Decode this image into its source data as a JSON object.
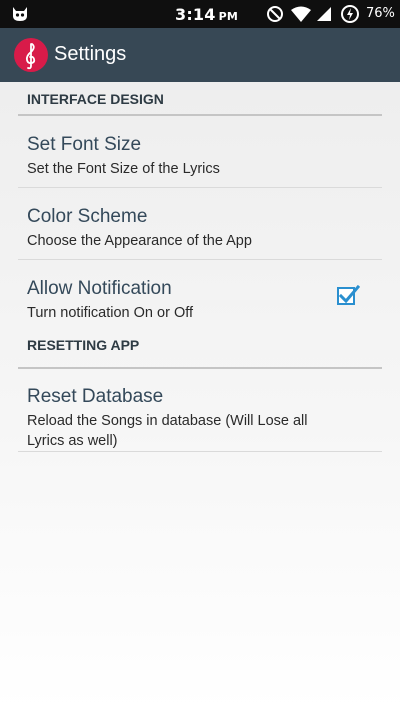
{
  "status_bar": {
    "time": "3:14",
    "ampm": "PM",
    "battery": "76%"
  },
  "toolbar": {
    "title": "Settings"
  },
  "sections": {
    "interface": {
      "header": "INTERFACE DESIGN",
      "font_size": {
        "title": "Set Font Size",
        "summary": "Set the Font Size of the Lyrics"
      },
      "color_scheme": {
        "title": "Color Scheme",
        "summary": "Choose the Appearance of the App"
      },
      "notification": {
        "title": "Allow Notification",
        "summary": "Turn notification On or Off",
        "checked": true
      }
    },
    "resetting": {
      "header": "RESETTING APP",
      "reset_db": {
        "title": "Reset Database",
        "summary": "Reload the Songs in database (Will Lose all Lyrics as well)"
      }
    }
  },
  "colors": {
    "toolbar": "#374855",
    "accent": "#2a8fcf",
    "logo": "#d81b49"
  }
}
